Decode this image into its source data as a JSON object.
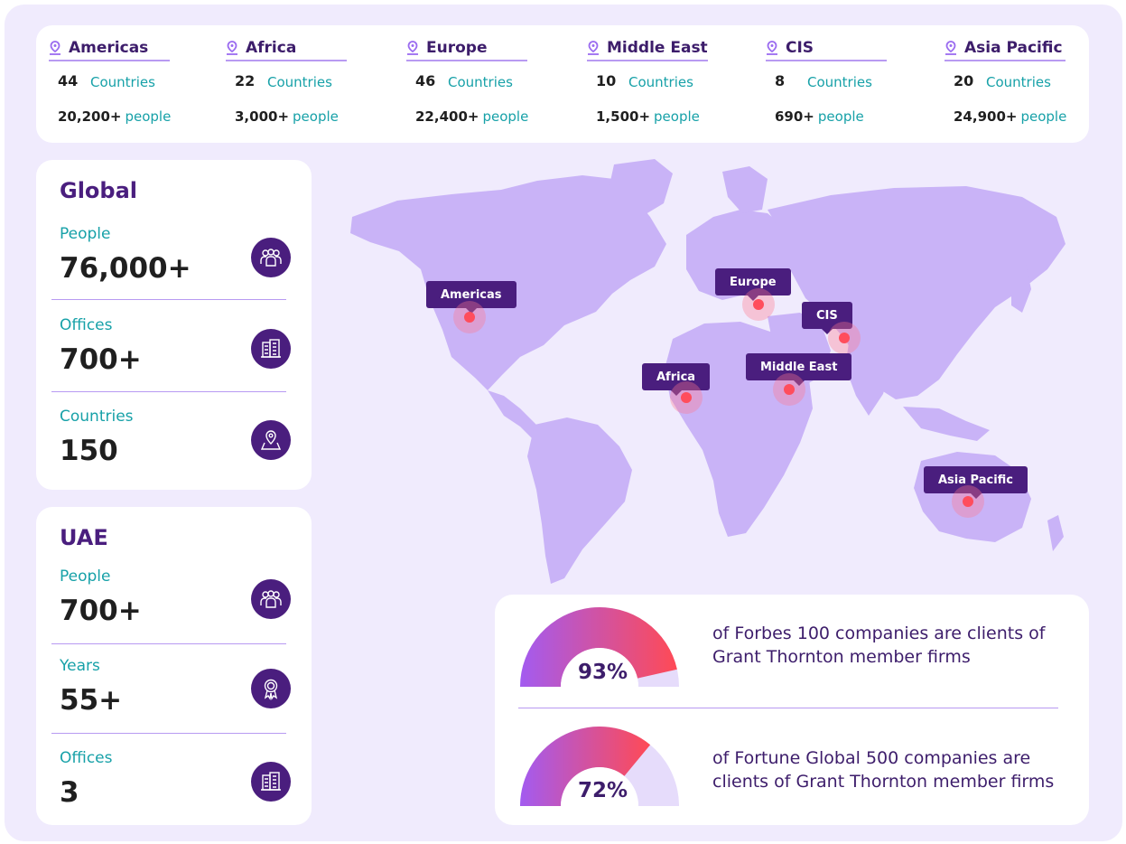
{
  "regions": [
    {
      "name": "Americas",
      "count": "44",
      "count_label": "Countries",
      "people": "20,200+",
      "people_label": "people"
    },
    {
      "name": "Africa",
      "count": "22",
      "count_label": "Countries",
      "people": "3,000+",
      "people_label": "people"
    },
    {
      "name": "Europe",
      "count": "46",
      "count_label": "Countries",
      "people": "22,400+",
      "people_label": "people"
    },
    {
      "name": "Middle East",
      "count": "10",
      "count_label": "Countries",
      "people": "1,500+",
      "people_label": "people"
    },
    {
      "name": "CIS",
      "count": "8",
      "count_label": "Countries",
      "people": "690+",
      "people_label": "people"
    },
    {
      "name": "Asia Pacific",
      "count": "20",
      "count_label": "Countries",
      "people": "24,900+",
      "people_label": "people"
    }
  ],
  "global": {
    "title": "Global",
    "stats": [
      {
        "label": "People",
        "value": "76,000+",
        "icon": "people-group-icon"
      },
      {
        "label": "Offices",
        "value": "700+",
        "icon": "building-icon"
      },
      {
        "label": "Countries",
        "value": "150",
        "icon": "map-pin-icon"
      }
    ]
  },
  "uae": {
    "title": "UAE",
    "stats": [
      {
        "label": "People",
        "value": "700+",
        "icon": "people-group-icon"
      },
      {
        "label": "Years",
        "value": "55+",
        "icon": "award-ribbon-icon"
      },
      {
        "label": "Offices",
        "value": "3",
        "icon": "building-icon"
      }
    ]
  },
  "map_markers": [
    "Americas",
    "Europe",
    "CIS",
    "Africa",
    "Middle East",
    "Asia Pacific"
  ],
  "gauges": [
    {
      "percent_label": "93%",
      "value": 93,
      "text": "of Forbes 100 companies are clients of Grant Thornton member firms"
    },
    {
      "percent_label": "72%",
      "value": 72,
      "text": "of Fortune Global 500 companies are clients of Grant Thornton member firms"
    }
  ],
  "colors": {
    "brand_purple": "#4a1e7e",
    "teal": "#17a1a8",
    "background": "#f0ebfd",
    "map_land": "#c9b3f7",
    "marker_dot": "#ff4d5c"
  }
}
